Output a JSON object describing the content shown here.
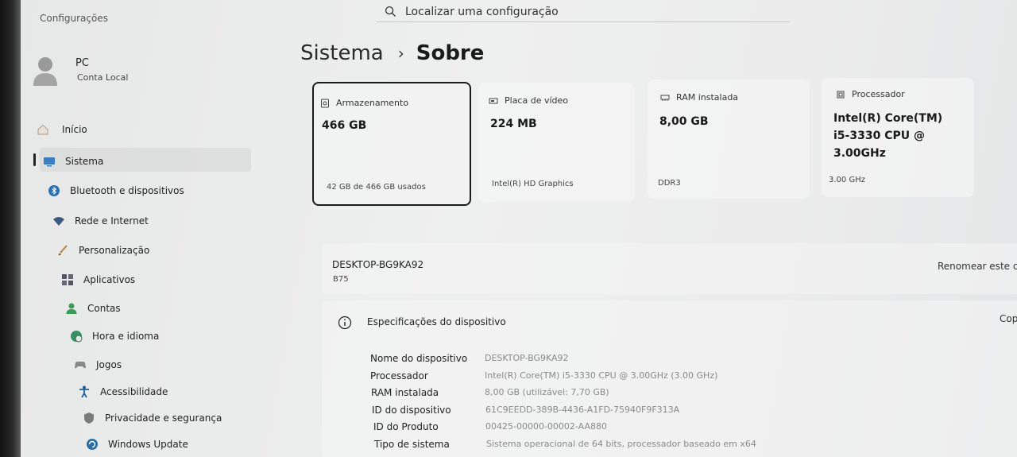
{
  "app": {
    "title": "Configurações"
  },
  "search": {
    "placeholder": "Localizar uma configuração"
  },
  "profile": {
    "name": "PC",
    "account": "Conta Local"
  },
  "sidebar": {
    "items": [
      {
        "label": "Início",
        "icon": "home-icon"
      },
      {
        "label": "Sistema",
        "icon": "system-icon",
        "active": true
      },
      {
        "label": "Bluetooth e dispositivos",
        "icon": "bluetooth-icon"
      },
      {
        "label": "Rede e Internet",
        "icon": "wifi-icon"
      },
      {
        "label": "Personalização",
        "icon": "brush-icon"
      },
      {
        "label": "Aplicativos",
        "icon": "apps-icon"
      },
      {
        "label": "Contas",
        "icon": "accounts-icon"
      },
      {
        "label": "Hora e idioma",
        "icon": "globe-clock-icon"
      },
      {
        "label": "Jogos",
        "icon": "gamepad-icon"
      },
      {
        "label": "Acessibilidade",
        "icon": "accessibility-icon"
      },
      {
        "label": "Privacidade e segurança",
        "icon": "shield-icon"
      },
      {
        "label": "Windows Update",
        "icon": "update-icon"
      }
    ]
  },
  "breadcrumb": {
    "parent": "Sistema",
    "separator": "›",
    "current": "Sobre"
  },
  "cards": {
    "storage": {
      "label": "Armazenamento",
      "value": "466 GB",
      "detail": "42 GB de 466 GB usados"
    },
    "gpu": {
      "label": "Placa de vídeo",
      "value": "224 MB",
      "detail": "Intel(R) HD Graphics"
    },
    "ram": {
      "label": "RAM instalada",
      "value": "8,00 GB",
      "detail": "DDR3"
    },
    "cpu": {
      "label": "Processador",
      "value_lines": [
        "Intel(R) Core(TM)",
        "i5-3330 CPU @",
        "3.00GHz"
      ],
      "detail": "3.00 GHz"
    }
  },
  "device": {
    "name": "DESKTOP-BG9KA92",
    "model": "B75",
    "rename_label": "Renomear este c"
  },
  "specs": {
    "title": "Especificações do dispositivo",
    "copy_label": "Cop",
    "rows": [
      {
        "key": "Nome do dispositivo",
        "value": "DESKTOP-BG9KA92"
      },
      {
        "key": "Processador",
        "value": "Intel(R) Core(TM) i5-3330 CPU @ 3.00GHz (3.00 GHz)"
      },
      {
        "key": "RAM instalada",
        "value": "8,00 GB (utilizável: 7,70 GB)"
      },
      {
        "key": "ID do dispositivo",
        "value": "61C9EEDD-389B-4436-A1FD-75940F9F313A"
      },
      {
        "key": "ID do Produto",
        "value": "00425-00000-00002-AA880"
      },
      {
        "key": "Tipo de sistema",
        "value": "Sistema operacional de 64 bits, processador baseado em x64"
      }
    ]
  }
}
